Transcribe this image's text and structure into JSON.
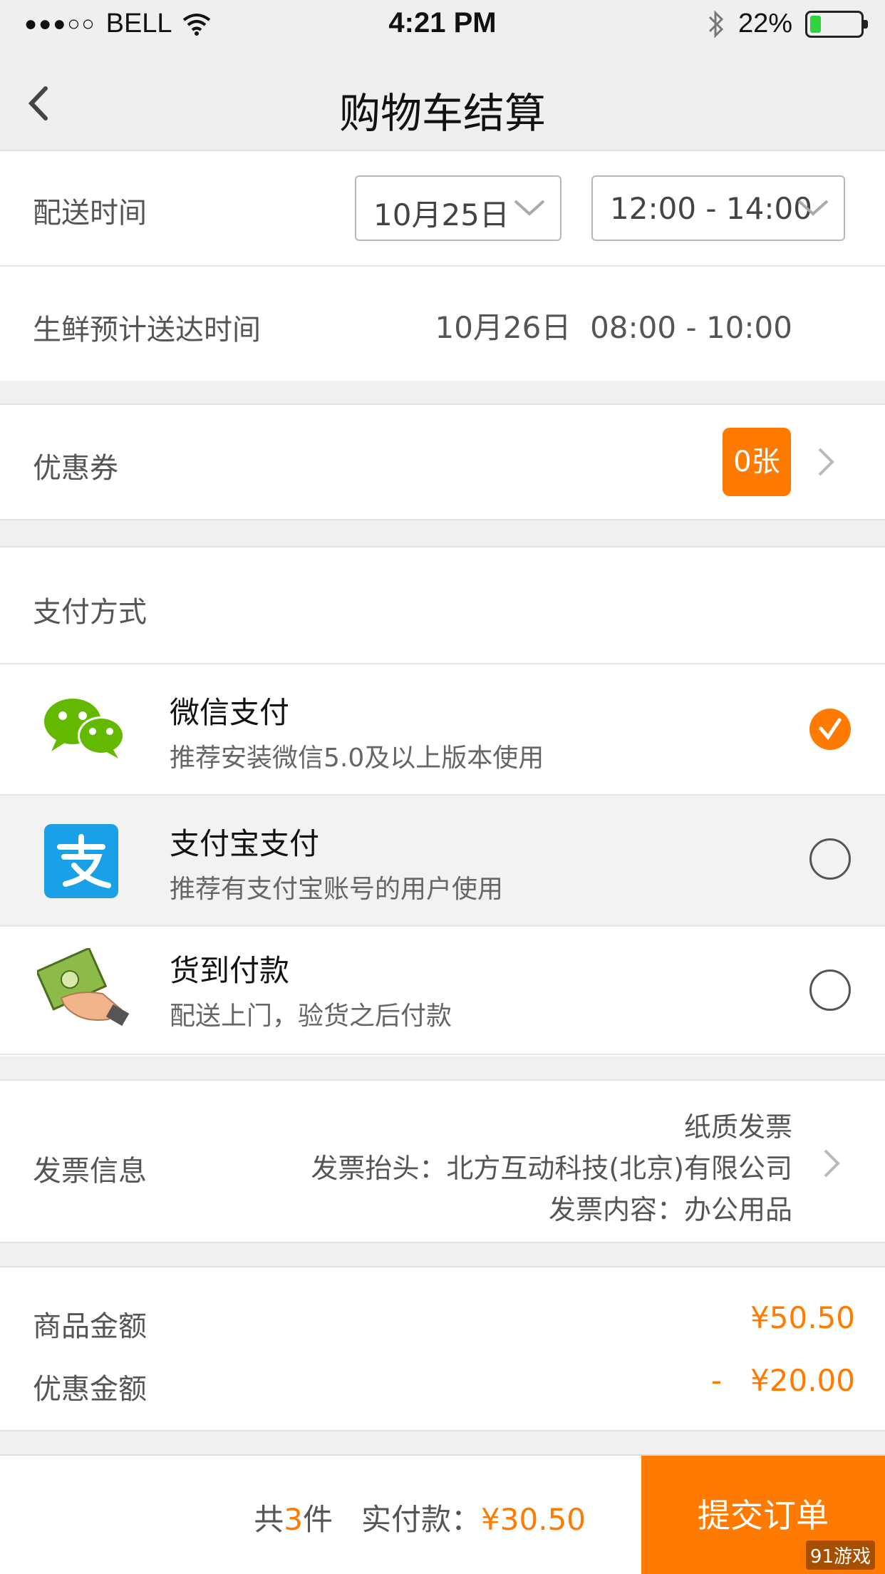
{
  "status_bar": {
    "signal": "●●●○○",
    "carrier": "BELL",
    "time": "4:21 PM",
    "battery": "22%",
    "battery_level": 0.22,
    "battery_color": "#2fd33c"
  },
  "nav": {
    "title": "购物车结算"
  },
  "delivery": {
    "label": "配送时间",
    "date": "10月25日",
    "time_slot": "12:00 - 14:00"
  },
  "fresh_arrival": {
    "label": "生鲜预计送达时间",
    "date": "10月26日",
    "time": "08:00 - 10:00"
  },
  "coupon": {
    "label": "优惠券",
    "count": "0张"
  },
  "payment": {
    "section_label": "支付方式",
    "methods": [
      {
        "name": "微信支付",
        "desc": "推荐安装微信5.0及以上版本使用",
        "selected": true,
        "icon": "wechat-icon"
      },
      {
        "name": "支付宝支付",
        "desc": "推荐有支付宝账号的用户使用",
        "selected": false,
        "icon": "alipay-icon"
      },
      {
        "name": "货到付款",
        "desc": "配送上门，验货之后付款",
        "selected": false,
        "icon": "cash-icon"
      }
    ]
  },
  "invoice": {
    "label": "发票信息",
    "type": "纸质发票",
    "title": "发票抬头：北方互动科技(北京)有限公司",
    "content": "发票内容：办公用品"
  },
  "amounts": {
    "goods_label": "商品金额",
    "goods_value": "¥50.50",
    "discount_label": "优惠金额",
    "discount_value": "-   ¥20.00"
  },
  "footer": {
    "count_prefix": "共",
    "count": "3",
    "count_suffix": "件",
    "pay_label": "实付款：",
    "pay_value": "¥30.50",
    "submit_label": "提交订单",
    "watermark": "91游戏"
  },
  "colors": {
    "accent": "#ff7a00",
    "wechat_green": "#62b900",
    "alipay_blue": "#1aa0e6"
  }
}
